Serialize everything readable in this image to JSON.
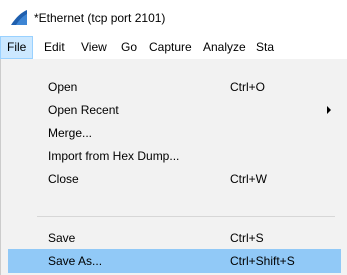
{
  "window": {
    "title": "*Ethernet (tcp port 2101)",
    "icon": "wireshark-fin-icon"
  },
  "menubar": {
    "items": [
      {
        "label": "File",
        "active": true
      },
      {
        "label": "Edit"
      },
      {
        "label": "View"
      },
      {
        "label": "Go"
      },
      {
        "label": "Capture"
      },
      {
        "label": "Analyze"
      },
      {
        "label": "Sta"
      }
    ]
  },
  "file_menu": {
    "items": [
      {
        "label": "Open",
        "shortcut": "Ctrl+O"
      },
      {
        "label": "Open Recent",
        "shortcut": "",
        "submenu": true
      },
      {
        "label": "Merge...",
        "shortcut": ""
      },
      {
        "label": "Import from Hex Dump...",
        "shortcut": ""
      },
      {
        "label": "Close",
        "shortcut": "Ctrl+W"
      },
      {
        "label": "Save",
        "shortcut": "Ctrl+S"
      },
      {
        "label": "Save As...",
        "shortcut": "Ctrl+Shift+S",
        "highlighted": true
      }
    ]
  },
  "colors": {
    "menu_background": "#f2f2f2",
    "highlight": "#91c9f7",
    "active_menu": "#cce8ff",
    "app_icon": "#1f5fae"
  }
}
